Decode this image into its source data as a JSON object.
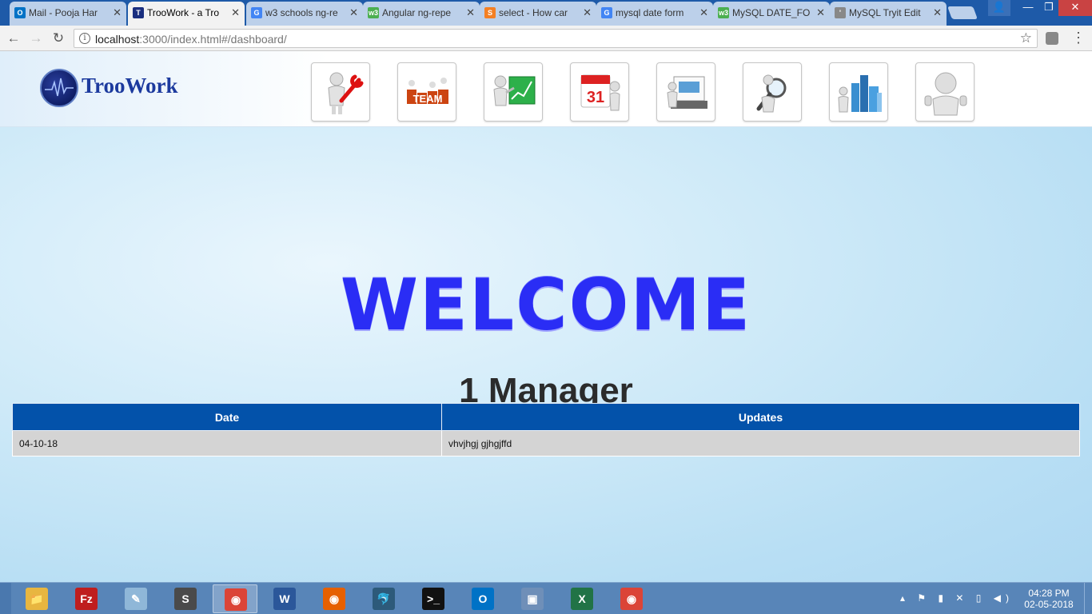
{
  "browser": {
    "tabs": [
      {
        "title": "Mail - Pooja Har",
        "icon": "outlook-icon",
        "color": "#0072c6",
        "glyph": "O"
      },
      {
        "title": "TrooWork - a Tro",
        "icon": "troowork-icon",
        "color": "#1a2f80",
        "glyph": "T"
      },
      {
        "title": "w3 schools ng-re",
        "icon": "google-icon",
        "color": "#4285f4",
        "glyph": "G"
      },
      {
        "title": "Angular ng-repe",
        "icon": "w3schools-icon",
        "color": "#4caf50",
        "glyph": "w3"
      },
      {
        "title": "select - How car",
        "icon": "stackoverflow-icon",
        "color": "#f48024",
        "glyph": "S"
      },
      {
        "title": "mysql date form",
        "icon": "google-icon",
        "color": "#4285f4",
        "glyph": "G"
      },
      {
        "title": "MySQL DATE_FO",
        "icon": "w3schools-icon",
        "color": "#4caf50",
        "glyph": "w3"
      },
      {
        "title": "MySQL Tryit Edit",
        "icon": "tryit-icon",
        "color": "#888888",
        "glyph": "'"
      }
    ],
    "active_tab": 1,
    "close_glyph": "✕",
    "url": {
      "host": "localhost",
      "rest": ":3000/index.html#/dashboard/"
    },
    "window_controls": {
      "min": "—",
      "max": "❐",
      "close": "✕",
      "user": "👤"
    }
  },
  "header": {
    "logo_text": "TrooWork",
    "nav_tiles": [
      {
        "name": "nav-tile-maintenance",
        "icon": "wrench-figure-icon"
      },
      {
        "name": "nav-tile-team",
        "icon": "team-icon"
      },
      {
        "name": "nav-tile-reports",
        "icon": "chart-presenter-icon"
      },
      {
        "name": "nav-tile-calendar",
        "icon": "calendar-icon",
        "day": "31"
      },
      {
        "name": "nav-tile-inventory",
        "icon": "file-cabinet-icon"
      },
      {
        "name": "nav-tile-inspection",
        "icon": "magnifier-figure-icon"
      },
      {
        "name": "nav-tile-buildings",
        "icon": "buildings-icon"
      },
      {
        "name": "nav-tile-profile",
        "icon": "thumbs-up-figure-icon"
      }
    ]
  },
  "main": {
    "welcome": "WELCOME",
    "subtitle": "1 Manager",
    "table": {
      "headers": [
        "Date",
        "Updates"
      ],
      "rows": [
        {
          "date": "04-10-18",
          "update": "vhvjhgj gjhgjffd"
        }
      ]
    }
  },
  "taskbar": {
    "apps": [
      {
        "name": "explorer",
        "icon": "folder-icon",
        "color": "#e8b640",
        "glyph": "📁",
        "active": false
      },
      {
        "name": "filezilla",
        "icon": "filezilla-icon",
        "color": "#bf1e1e",
        "glyph": "Fz",
        "active": false
      },
      {
        "name": "notepad",
        "icon": "notepad-icon",
        "color": "#8fb7d8",
        "glyph": "✎",
        "active": false
      },
      {
        "name": "sublime",
        "icon": "sublime-icon",
        "color": "#4a4a4a",
        "glyph": "S",
        "active": false
      },
      {
        "name": "chrome",
        "icon": "chrome-icon",
        "color": "#db4437",
        "glyph": "◉",
        "active": true
      },
      {
        "name": "word",
        "icon": "word-icon",
        "color": "#2b579a",
        "glyph": "W",
        "active": false
      },
      {
        "name": "firefox",
        "icon": "firefox-icon",
        "color": "#e66000",
        "glyph": "◉",
        "active": false
      },
      {
        "name": "mysql-workbench",
        "icon": "mysql-icon",
        "color": "#2d5a7a",
        "glyph": "🐬",
        "active": false
      },
      {
        "name": "cmd",
        "icon": "terminal-icon",
        "color": "#111111",
        "glyph": ">_",
        "active": false
      },
      {
        "name": "outlook",
        "icon": "outlook-icon",
        "color": "#0072c6",
        "glyph": "O",
        "active": false
      },
      {
        "name": "virtualbox",
        "icon": "box-icon",
        "color": "#6f8fb8",
        "glyph": "▣",
        "active": false
      },
      {
        "name": "excel",
        "icon": "excel-icon",
        "color": "#217346",
        "glyph": "X",
        "active": false
      },
      {
        "name": "chrome-2",
        "icon": "chrome-icon",
        "color": "#db4437",
        "glyph": "◉",
        "active": false
      }
    ],
    "tray": "▴ ⚑ ▮ ✕ ▯ ◀)",
    "time": "04:28 PM",
    "date": "02-05-2018"
  }
}
